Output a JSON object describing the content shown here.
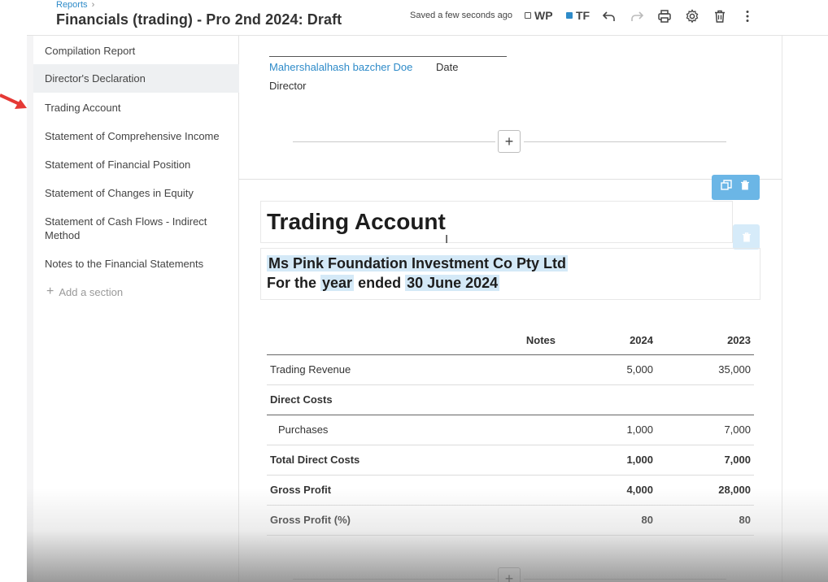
{
  "header": {
    "breadcrumb": "Reports",
    "breadcrumb_sep": "›",
    "title": "Financials (trading) - Pro 2nd 2024: Draft",
    "save_status": "Saved a few seconds ago",
    "toggles": [
      {
        "label": "WP",
        "checked": false
      },
      {
        "label": "TF",
        "checked": true
      }
    ],
    "icons": [
      "undo-icon",
      "redo-icon",
      "print-icon",
      "gear-icon",
      "trash-icon",
      "more-vertical-icon"
    ]
  },
  "sidebar": {
    "items": [
      {
        "label": "Compilation Report"
      },
      {
        "label": "Director's Declaration",
        "active": true
      },
      {
        "label": "Trading Account"
      },
      {
        "label": "Statement of Comprehensive Income"
      },
      {
        "label": "Statement of Financial Position"
      },
      {
        "label": "Statement of Changes in Equity"
      },
      {
        "label": "Statement of Cash Flows - Indirect Method"
      },
      {
        "label": "Notes to the Financial Statements"
      }
    ],
    "add_section": "Add a section"
  },
  "signature": {
    "name": "Mahershalalhash bazcher Doe",
    "date_label": "Date",
    "role": "Director"
  },
  "section": {
    "title": "Trading Account",
    "entity": "Ms Pink Foundation Investment Co Pty Ltd",
    "period_prefix": "For the",
    "period_word": "year",
    "period_mid": "ended",
    "period_date": "30 June 2024"
  },
  "table": {
    "columns": [
      "",
      "Notes",
      "2024",
      "2023"
    ],
    "rows": [
      {
        "label": "Trading Revenue",
        "notes": "",
        "y2024": "5,000",
        "y2023": "35,000",
        "style": "normal"
      },
      {
        "label": "Direct Costs",
        "notes": "",
        "y2024": "",
        "y2023": "",
        "style": "group"
      },
      {
        "label": "Purchases",
        "notes": "",
        "y2024": "1,000",
        "y2023": "7,000",
        "style": "indent"
      },
      {
        "label": "Total Direct Costs",
        "notes": "",
        "y2024": "1,000",
        "y2023": "7,000",
        "style": "bold"
      },
      {
        "label": "Gross Profit",
        "notes": "",
        "y2024": "4,000",
        "y2023": "28,000",
        "style": "bold"
      },
      {
        "label": "Gross Profit (%)",
        "notes": "",
        "y2024": "80",
        "y2023": "80",
        "style": "bold"
      }
    ]
  },
  "colors": {
    "accent": "#2e8bc9",
    "highlight": "#d4e9f7",
    "toolbar_blue": "#6bb6e6",
    "arrow_red": "#e53935"
  }
}
